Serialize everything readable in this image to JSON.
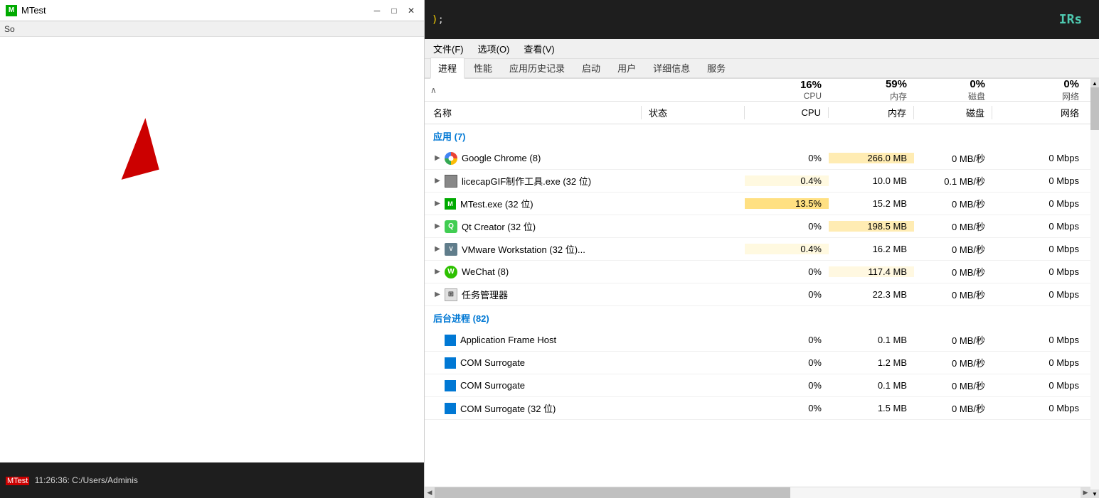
{
  "left_window": {
    "title": "MTest",
    "icon_label": "M",
    "top_bar_text": "So",
    "status_bar": {
      "label": "MTest",
      "timestamp": "11:26:36: C:/Users/Adminis"
    }
  },
  "code_strip": {
    "text": "); ",
    "irs_label": "IRs"
  },
  "menu": {
    "items": [
      "文件(F)",
      "选项(O)",
      "查看(V)"
    ]
  },
  "tabs": {
    "items": [
      "进程",
      "性能",
      "应用历史记录",
      "启动",
      "用户",
      "详细信息",
      "服务"
    ],
    "active": "进程"
  },
  "columns": {
    "sort_arrow": "∧",
    "name": "名称",
    "status": "状态",
    "cpu": "CPU",
    "mem": "内存",
    "disk": "磁盘",
    "net": "网络"
  },
  "stats": {
    "cpu_pct": "16%",
    "mem_pct": "59%",
    "disk_pct": "0%",
    "net_pct": "0%"
  },
  "apps_section": {
    "label": "应用 (7)",
    "rows": [
      {
        "name": "Google Chrome (8)",
        "icon_type": "chrome",
        "status": "",
        "cpu": "0%",
        "mem": "266.0 MB",
        "disk": "0 MB/秒",
        "net": "0 Mbps",
        "cpu_class": "",
        "mem_class": "mem-high"
      },
      {
        "name": "licecapGIF制作工具.exe (32 位)",
        "icon_type": "licecap",
        "status": "",
        "cpu": "0.4%",
        "mem": "10.0 MB",
        "disk": "0.1 MB/秒",
        "net": "0 Mbps",
        "cpu_class": "cpu-medium",
        "mem_class": ""
      },
      {
        "name": "MTest.exe (32 位)",
        "icon_type": "mtest",
        "status": "",
        "cpu": "13.5%",
        "mem": "15.2 MB",
        "disk": "0 MB/秒",
        "net": "0 Mbps",
        "cpu_class": "cpu-high",
        "mem_class": ""
      },
      {
        "name": "Qt Creator (32 位)",
        "icon_type": "qt",
        "status": "",
        "cpu": "0%",
        "mem": "198.5 MB",
        "disk": "0 MB/秒",
        "net": "0 Mbps",
        "cpu_class": "",
        "mem_class": "mem-high"
      },
      {
        "name": "VMware Workstation (32 位)...",
        "icon_type": "vmware",
        "status": "",
        "cpu": "0.4%",
        "mem": "16.2 MB",
        "disk": "0 MB/秒",
        "net": "0 Mbps",
        "cpu_class": "cpu-medium",
        "mem_class": ""
      },
      {
        "name": "WeChat (8)",
        "icon_type": "wechat",
        "status": "",
        "cpu": "0%",
        "mem": "117.4 MB",
        "disk": "0 MB/秒",
        "net": "0 Mbps",
        "cpu_class": "",
        "mem_class": "mem-medium"
      },
      {
        "name": "任务管理器",
        "icon_type": "taskm",
        "status": "",
        "cpu": "0%",
        "mem": "22.3 MB",
        "disk": "0 MB/秒",
        "net": "0 Mbps",
        "cpu_class": "",
        "mem_class": ""
      }
    ]
  },
  "bg_section": {
    "label": "后台进程 (82)",
    "rows": [
      {
        "name": "Application Frame Host",
        "icon_type": "bluesq",
        "status": "",
        "cpu": "0%",
        "mem": "0.1 MB",
        "disk": "0 MB/秒",
        "net": "0 Mbps",
        "cpu_class": "",
        "mem_class": ""
      },
      {
        "name": "COM Surrogate",
        "icon_type": "bluesq",
        "status": "",
        "cpu": "0%",
        "mem": "1.2 MB",
        "disk": "0 MB/秒",
        "net": "0 Mbps",
        "cpu_class": "",
        "mem_class": ""
      },
      {
        "name": "COM Surrogate",
        "icon_type": "bluesq",
        "status": "",
        "cpu": "0%",
        "mem": "0.1 MB",
        "disk": "0 MB/秒",
        "net": "0 Mbps",
        "cpu_class": "",
        "mem_class": ""
      },
      {
        "name": "COM Surrogate (32 位)",
        "icon_type": "bluesq",
        "status": "",
        "cpu": "0%",
        "mem": "1.5 MB",
        "disk": "0 MB/秒",
        "net": "0 Mbps",
        "cpu_class": "",
        "mem_class": ""
      }
    ]
  },
  "scrollbar": {
    "up_arrow": "▲",
    "down_arrow": "▼",
    "left_arrow": "◀",
    "right_arrow": "▶"
  }
}
